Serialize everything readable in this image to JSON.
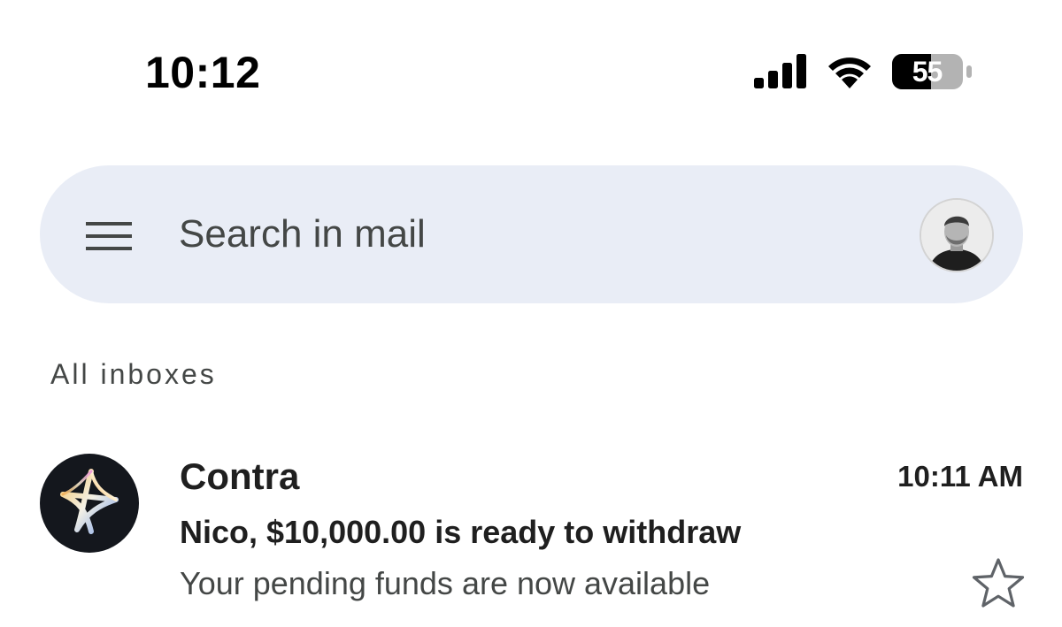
{
  "status_bar": {
    "time": "10:12",
    "battery_level": "55",
    "icons": [
      "signal-icon",
      "wifi-icon",
      "battery-icon"
    ]
  },
  "search": {
    "placeholder": "Search in mail",
    "menu_icon": "menu-icon",
    "account_avatar": "user-avatar"
  },
  "section": {
    "label": "All inboxes"
  },
  "emails": [
    {
      "sender": "Contra",
      "time": "10:11 AM",
      "subject": "Nico, $10,000.00 is ready to withdraw",
      "snippet": "Your pending funds are now available",
      "starred": false,
      "avatar_icon": "contra-logo"
    }
  ],
  "colors": {
    "search_bg": "#e9edf6",
    "primary_text": "#1f1f1f",
    "secondary_text": "#444746",
    "sender_avatar_bg": "#14171d"
  }
}
